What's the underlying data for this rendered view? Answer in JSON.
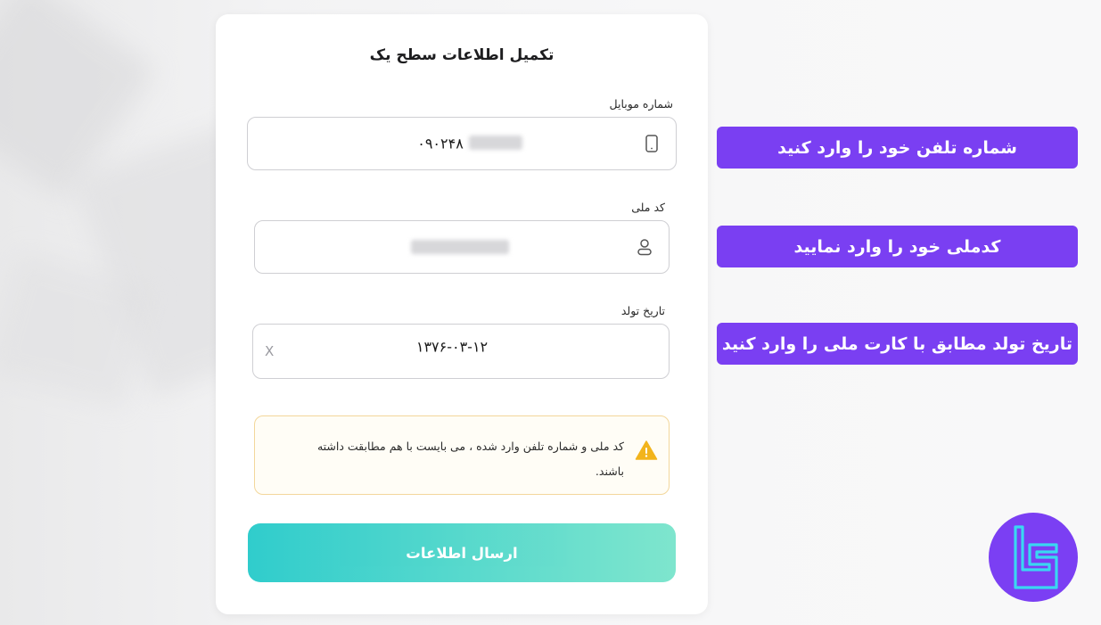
{
  "form": {
    "title": "تکمیل اطلاعات سطح یک",
    "mobile": {
      "label": "شماره موبایل",
      "value": "۰۹۰۲۴۸",
      "icon": "mobile-icon"
    },
    "national_code": {
      "label": "کد ملی",
      "value": "",
      "icon": "user-icon"
    },
    "birth_date": {
      "label": "تاریخ تولد",
      "value": "۱۳۷۶-۰۳-۱۲",
      "clear": "X"
    },
    "warning": {
      "icon": "warning-icon",
      "text": "کد ملی و شماره تلفن وارد شده ، می بایست با هم مطابقت داشته باشند."
    },
    "submit_label": "ارسال اطلاعات"
  },
  "hints": [
    "شماره تلفن خود را وارد کنید",
    "کدملی خود را وارد نمایید",
    "تاریخ تولد مطابق با کارت ملی را وارد کنید"
  ],
  "colors": {
    "hint_bg": "#7a3ff2",
    "button_gradient_start": "#1ec8c8",
    "button_gradient_end": "#73e3c9",
    "warning_border": "#f3d79b",
    "warning_icon": "#f2b41c",
    "logo_bg": "#7b3ff3",
    "logo_mark": "#39d7f2"
  },
  "logo": {
    "icon": "brand-logo-icon"
  }
}
